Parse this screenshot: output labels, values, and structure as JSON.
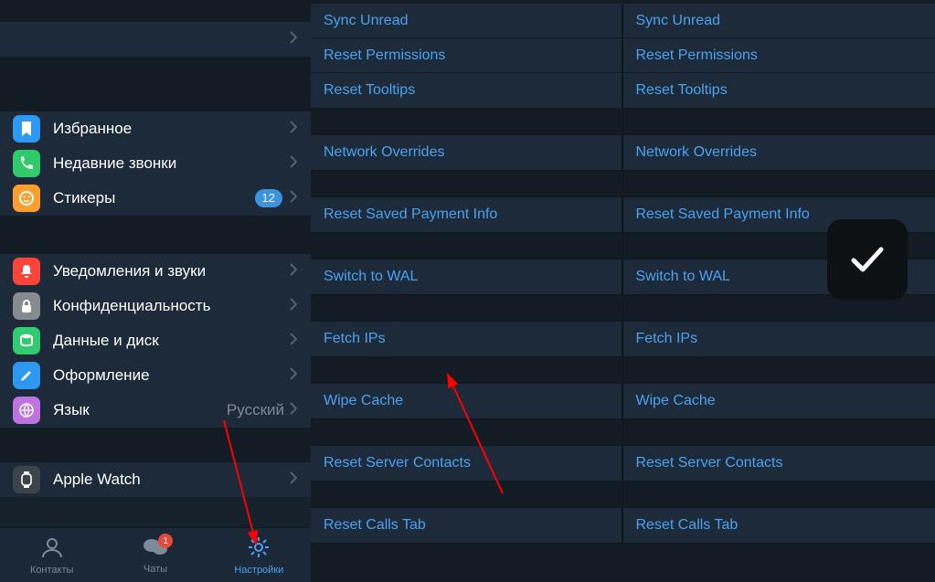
{
  "sidebar": {
    "top_blank": "",
    "items": [
      {
        "label": "Избранное",
        "icon": "bookmark",
        "color": "ic-blue"
      },
      {
        "label": "Недавние звонки",
        "icon": "phone",
        "color": "ic-green"
      },
      {
        "label": "Стикеры",
        "icon": "sticker",
        "color": "ic-orange",
        "badge": "12"
      }
    ],
    "items2": [
      {
        "label": "Уведомления и звуки",
        "icon": "bell",
        "color": "ic-red"
      },
      {
        "label": "Конфиденциальность",
        "icon": "lock",
        "color": "ic-gray"
      },
      {
        "label": "Данные и диск",
        "icon": "data",
        "color": "ic-greend"
      },
      {
        "label": "Оформление",
        "icon": "brush",
        "color": "ic-blue2"
      },
      {
        "label": "Язык",
        "icon": "globe",
        "color": "ic-purple",
        "value": "Русский"
      }
    ],
    "items3": [
      {
        "label": "Apple Watch",
        "icon": "watch",
        "color": "ic-dark"
      }
    ]
  },
  "tabs": {
    "contacts": {
      "label": "Контакты"
    },
    "chats": {
      "label": "Чаты",
      "badge": "1"
    },
    "settings": {
      "label": "Настройки"
    }
  },
  "debug": {
    "groups": [
      {
        "items": [
          "Sync Unread",
          "Reset Permissions",
          "Reset Tooltips"
        ]
      },
      {
        "items": [
          "Network Overrides"
        ]
      },
      {
        "items": [
          "Reset Saved Payment Info"
        ]
      },
      {
        "items": [
          "Switch to WAL"
        ]
      },
      {
        "items": [
          "Fetch IPs"
        ]
      },
      {
        "items": [
          "Wipe Cache"
        ]
      },
      {
        "items": [
          "Reset Server Contacts"
        ]
      },
      {
        "items": [
          "Reset Calls Tab"
        ]
      }
    ]
  }
}
